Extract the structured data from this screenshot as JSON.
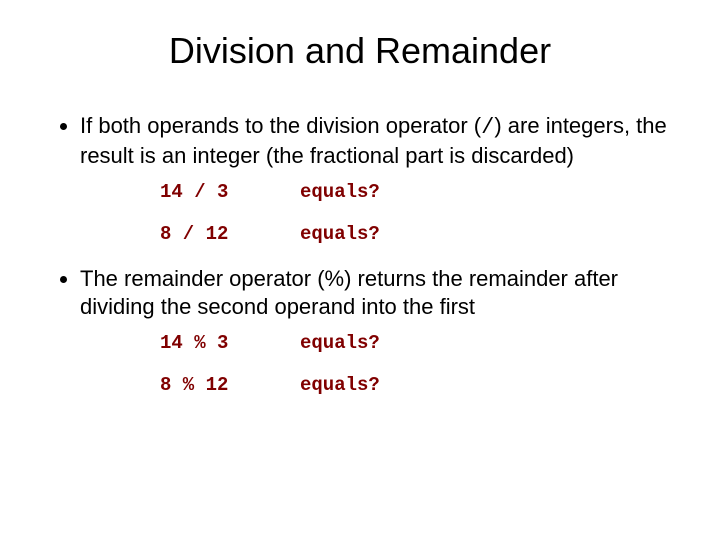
{
  "title": "Division and Remainder",
  "bullet1_a": "If both operands to the division operator (",
  "bullet1_op": "/",
  "bullet1_b": ") are integers, the result is an integer (the fractional part is discarded)",
  "div_examples": [
    {
      "expr": "14 / 3",
      "eq": "equals?"
    },
    {
      "expr": "8 / 12",
      "eq": "equals?"
    }
  ],
  "bullet2": "The remainder operator (%) returns the remainder after dividing the second operand into the first",
  "mod_examples": [
    {
      "expr": "14 % 3",
      "eq": "equals?"
    },
    {
      "expr": "8 % 12",
      "eq": "equals?"
    }
  ]
}
